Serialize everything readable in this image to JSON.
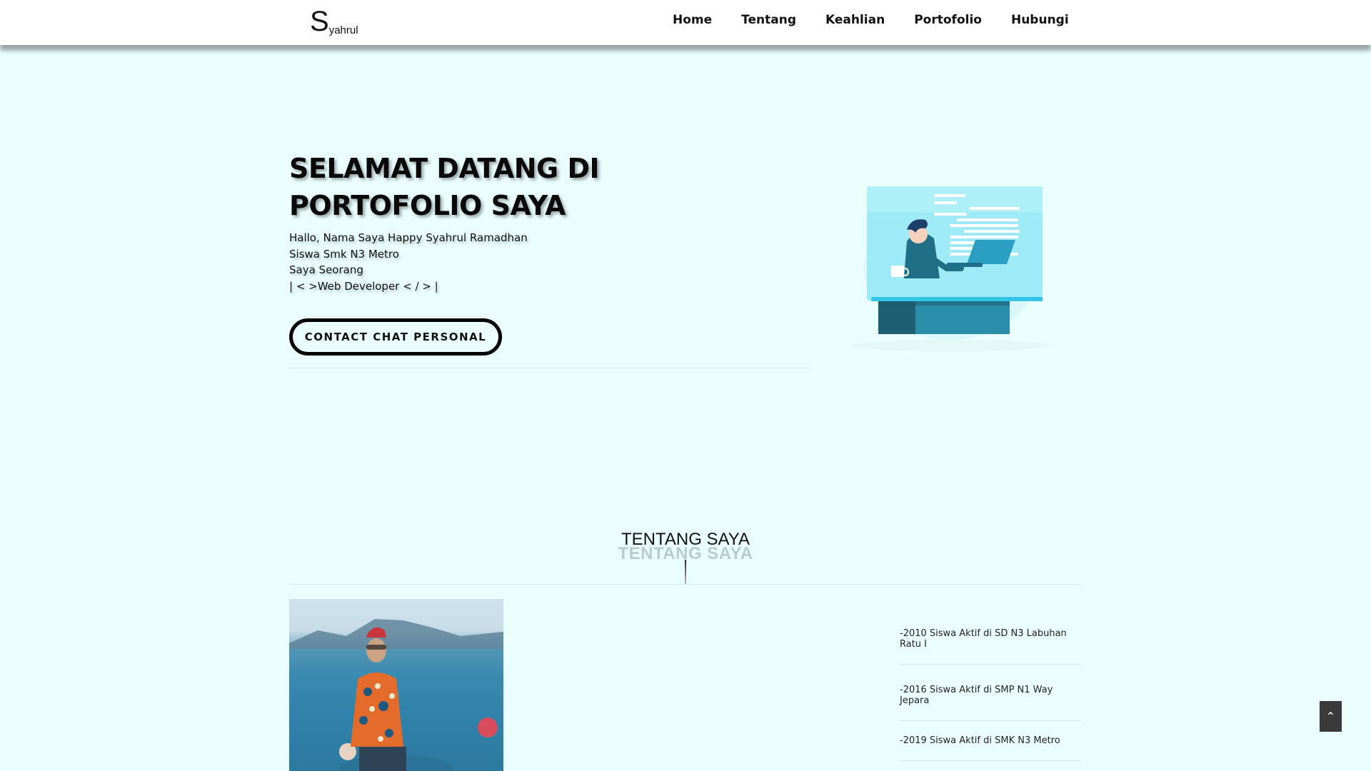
{
  "brand": {
    "initial": "S",
    "rest": "yahrul"
  },
  "nav": {
    "items": [
      "Home",
      "Tentang",
      "Keahlian",
      "Portofolio",
      "Hubungi"
    ]
  },
  "hero": {
    "title_line1": "SELAMAT DATANG DI",
    "title_line2": "PORTOFOLIO SAYA",
    "lines": [
      "Hallo, Nama Saya Happy Syahrul Ramadhan",
      "Siswa Smk N3 Metro",
      "Saya Seorang",
      "| < >Web Developer < / > |"
    ],
    "cta_label": "CONTACT CHAT PERSONAL"
  },
  "about": {
    "title": "TENTANG SAYA",
    "title_shadow": "TENTANG SAYA",
    "timeline": [
      "-2010 Siswa Aktif di SD N3 Labuhan Ratu I",
      "-2016 Siswa Aktif di SMP N1 Way Jepara",
      "-2019 Siswa Aktif di SMK N3 Metro"
    ]
  },
  "scroll_top": {
    "icon": "chevron-up-icon",
    "glyph": "⌃"
  },
  "colors": {
    "background": "#ebfefe",
    "navbar": "#ffffff",
    "scroll_button": "#3a3a3a"
  }
}
